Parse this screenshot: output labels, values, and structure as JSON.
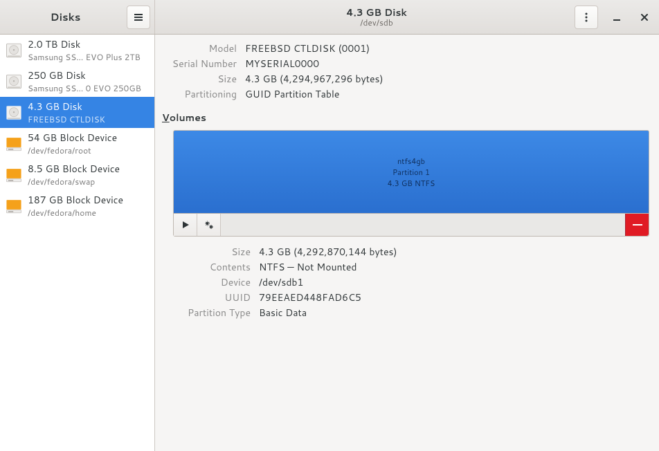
{
  "header": {
    "left_title": "Disks",
    "main_title": "4.3 GB Disk",
    "sub_title": "/dev/sdb"
  },
  "sidebar": {
    "items": [
      {
        "title": "2.0 TB Disk",
        "sub": "Samsung SS…  EVO Plus 2TB",
        "kind": "hdd",
        "selected": false
      },
      {
        "title": "250 GB Disk",
        "sub": "Samsung SS…  0 EVO 250GB",
        "kind": "hdd",
        "selected": false
      },
      {
        "title": "4.3 GB Disk",
        "sub": "FREEBSD CTLDISK",
        "kind": "hdd",
        "selected": true
      },
      {
        "title": "54 GB Block Device",
        "sub": "/dev/fedora/root",
        "kind": "block",
        "selected": false
      },
      {
        "title": "8.5 GB Block Device",
        "sub": "/dev/fedora/swap",
        "kind": "block",
        "selected": false
      },
      {
        "title": "187 GB Block Device",
        "sub": "/dev/fedora/home",
        "kind": "block",
        "selected": false
      }
    ]
  },
  "disk": {
    "model_label": "Model",
    "model_value": "FREEBSD CTLDISK (0001)",
    "serial_label": "Serial Number",
    "serial_value": "MYSERIAL0000",
    "size_label": "Size",
    "size_value": "4.3 GB (4,294,967,296 bytes)",
    "part_label": "Partitioning",
    "part_value": "GUID Partition Table"
  },
  "volumes": {
    "heading": "Volumes",
    "partition": {
      "name": "ntfs4gb",
      "line2": "Partition 1",
      "line3": "4.3 GB NTFS"
    },
    "info": {
      "size_label": "Size",
      "size_value": "4.3 GB (4,292,870,144 bytes)",
      "contents_label": "Contents",
      "contents_value": "NTFS — Not Mounted",
      "device_label": "Device",
      "device_value": "/dev/sdb1",
      "uuid_label": "UUID",
      "uuid_value": "79EEAED448FAD6C5",
      "pt_label": "Partition Type",
      "pt_value": "Basic Data"
    }
  }
}
